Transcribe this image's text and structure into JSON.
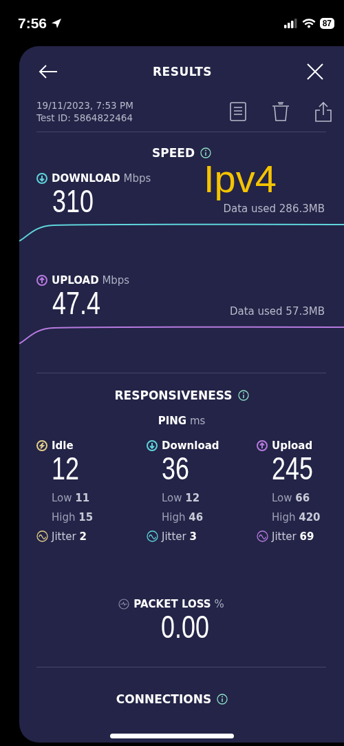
{
  "status_bar": {
    "time": "7:56",
    "battery": "87"
  },
  "header": {
    "title": "RESULTS"
  },
  "test": {
    "date": "19/11/2023, 7:53 PM",
    "test_id": "Test ID: 5864822464"
  },
  "speed": {
    "title": "SPEED",
    "metrics": [
      {
        "kind": "download",
        "label": "**DOWNLOAD** Mbps",
        "value": "310",
        "data_used": "Data used 286.3MB",
        "color": "#5fd4dc"
      },
      {
        "kind": "upload",
        "label": "**UPLOAD** Mbps",
        "value": "47.4",
        "data_used": "Data used 57.3MB",
        "color": "#b77ae0"
      }
    ]
  },
  "annotation": "Ipv4",
  "responsiveness": {
    "title": "RESPONSIVENESS",
    "ping": "**PING** ms",
    "columns": [
      {
        "kind": "idle",
        "label": "Idle",
        "value": "12",
        "low": "Low **11**",
        "high": "High **15**",
        "jitter": "Jitter **2**",
        "color": "#e3cf8a"
      },
      {
        "kind": "download",
        "label": "Download",
        "value": "36",
        "low": "Low **12**",
        "high": "High **46**",
        "jitter": "Jitter **3**",
        "color": "#5fd4dc"
      },
      {
        "kind": "upload",
        "label": "Upload",
        "value": "245",
        "low": "Low **66**",
        "high": "High **420**",
        "jitter": "Jitter **69**",
        "color": "#b77ae0"
      }
    ]
  },
  "packet_loss": {
    "label": "**PACKET LOSS** %",
    "value": "0.00"
  },
  "connections": {
    "title": "CONNECTIONS"
  }
}
